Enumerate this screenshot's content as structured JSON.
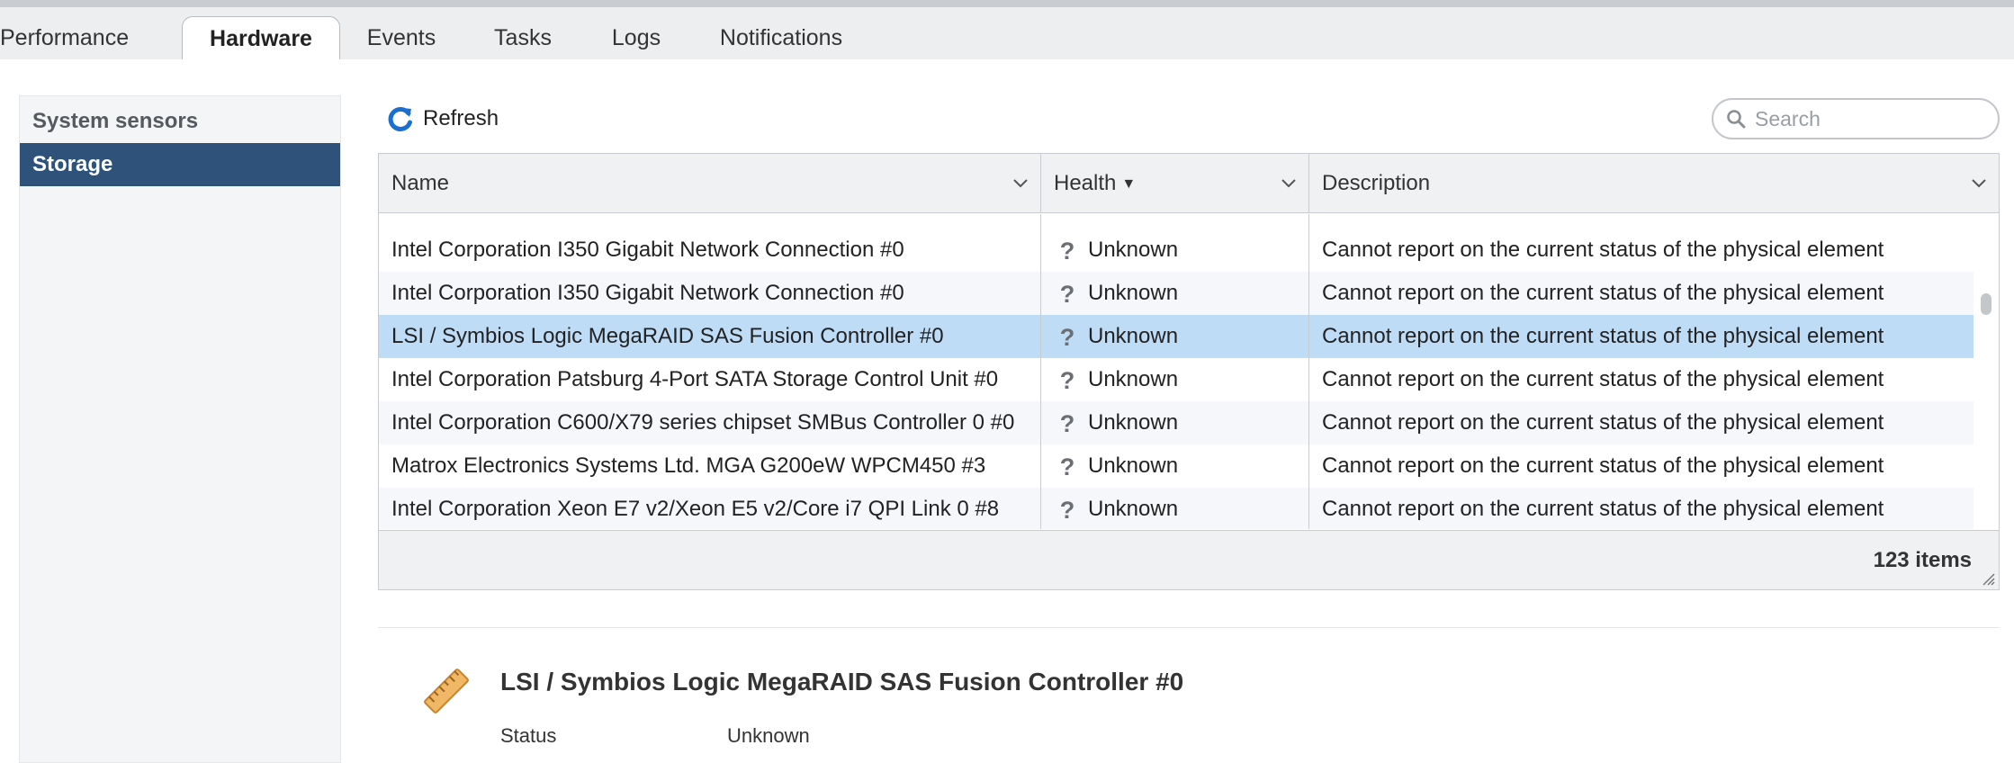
{
  "tabs": [
    "Performance",
    "Hardware",
    "Events",
    "Tasks",
    "Logs",
    "Notifications"
  ],
  "active_tab": "Hardware",
  "sidebar": {
    "items": [
      "System sensors",
      "Storage"
    ],
    "active": "Storage"
  },
  "toolbar": {
    "refresh_label": "Refresh",
    "search_placeholder": "Search"
  },
  "grid": {
    "columns": [
      "Name",
      "Health",
      "Description"
    ],
    "sorted_column": "Health",
    "rows": [
      {
        "name": "Intel Corporation I350 Gigabit Network Connection #0",
        "health": "Unknown",
        "description": "Cannot report on the current status of the physical element"
      },
      {
        "name": "Intel Corporation I350 Gigabit Network Connection #0",
        "health": "Unknown",
        "description": "Cannot report on the current status of the physical element"
      },
      {
        "name": "LSI / Symbios Logic MegaRAID SAS Fusion Controller #0",
        "health": "Unknown",
        "description": "Cannot report on the current status of the physical element",
        "selected": true
      },
      {
        "name": "Intel Corporation Patsburg 4-Port SATA Storage Control Unit #0",
        "health": "Unknown",
        "description": "Cannot report on the current status of the physical element"
      },
      {
        "name": "Intel Corporation C600/X79 series chipset SMBus Controller 0 #0",
        "health": "Unknown",
        "description": "Cannot report on the current status of the physical element"
      },
      {
        "name": "Matrox Electronics Systems Ltd. MGA G200eW WPCM450 #3",
        "health": "Unknown",
        "description": "Cannot report on the current status of the physical element"
      },
      {
        "name": "Intel Corporation Xeon E7 v2/Xeon E5 v2/Core i7 QPI Link 0 #8",
        "health": "Unknown",
        "description": "Cannot report on the current status of the physical element"
      }
    ],
    "item_count": "123 items"
  },
  "detail": {
    "title": "LSI / Symbios Logic MegaRAID SAS Fusion Controller #0",
    "status_label": "Status",
    "status_value": "Unknown"
  },
  "icons": {
    "refresh": "refresh-icon",
    "search": "search-icon",
    "health_unknown": "question-mark-icon",
    "detail": "ruler-icon"
  },
  "colors": {
    "sidebar_active": "#2e5279",
    "row_selected": "#bfdcf7",
    "refresh_icon": "#1a6fd0",
    "ruler_icon": "#e3a046"
  }
}
